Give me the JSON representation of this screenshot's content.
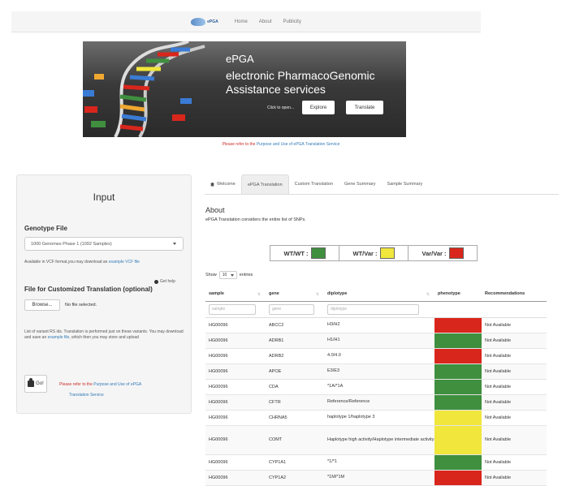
{
  "navbar": {
    "logo_text": "ePGA",
    "links": [
      "Home",
      "About",
      "Publicity"
    ]
  },
  "banner": {
    "title": "ePGA",
    "line1": "electronic PharmacoGenomic",
    "line2": "Assistance services",
    "click_text": "Click to open...",
    "explore_label": "Explore",
    "translate_label": "Translate",
    "note_prefix": "Please refer to the ",
    "note_link": "Purpose and Use of ePGA Translation Service"
  },
  "input_panel": {
    "title": "Input",
    "genotype_label": "Genotype File",
    "genotype_selected": "1000 Genomes Phase 1 (1092 Samples)",
    "help_text": "Available in VCF format,you may download an ",
    "help_link": "example VCF file",
    "get_help": "Get help",
    "custom_label": "File for Customized Translation (optional)",
    "browse_label": "Browse...",
    "no_file": "No file selected.",
    "variant_text": "List of variant RS ids. Translation is performed just on these variants. You may download and save an ",
    "variant_link": "example file",
    "variant_text_end": ", which then you may store and upload",
    "go_label": "Go!",
    "purpose_prefix": "Please refer to the ",
    "purpose_link1": "Purpose and Use of ePGA",
    "purpose_link2": "Translation Service"
  },
  "tabs": [
    {
      "label": "Welcome",
      "active": false
    },
    {
      "label": "ePGA Translation",
      "active": true
    },
    {
      "label": "Custom Translation",
      "active": false
    },
    {
      "label": "Gene Summary",
      "active": false
    },
    {
      "label": "Sample Summary",
      "active": false
    }
  ],
  "about": {
    "heading": "About",
    "text": "ePGA Translation considers the entire list of SNPs."
  },
  "legend": [
    {
      "label": "WT/WT :",
      "color": "#3f8f3f"
    },
    {
      "label": "WT/Var :",
      "color": "#f0e63c"
    },
    {
      "label": "Var/Var :",
      "color": "#d9261c"
    }
  ],
  "table": {
    "show_label": "Show",
    "length_value": "10",
    "entries_label": "entries",
    "columns": [
      "sample",
      "gene",
      "diplotype",
      "phenotype",
      "Recommendations"
    ],
    "filter_placeholders": [
      "sample",
      "gene",
      "diplotype"
    ],
    "rows": [
      {
        "sample": "HG00096",
        "gene": "ABCC2",
        "diplotype": "H3/H2",
        "phenotype_color": "#d9261c",
        "recommendation": "Not Available"
      },
      {
        "sample": "HG00096",
        "gene": "ADRB1",
        "diplotype": "H1/H1",
        "phenotype_color": "#3f8f3f",
        "recommendation": "Not Available"
      },
      {
        "sample": "HG00096",
        "gene": "ADRB2",
        "diplotype": "4.0/4.0",
        "phenotype_color": "#d9261c",
        "recommendation": "Not Available"
      },
      {
        "sample": "HG00096",
        "gene": "APOE",
        "diplotype": "E3/E3",
        "phenotype_color": "#3f8f3f",
        "recommendation": "Not Available"
      },
      {
        "sample": "HG00096",
        "gene": "CDA",
        "diplotype": "*1A/*1A",
        "phenotype_color": "#3f8f3f",
        "recommendation": "Not Available"
      },
      {
        "sample": "HG00096",
        "gene": "CFTR",
        "diplotype": "Reference/Reference",
        "phenotype_color": "#3f8f3f",
        "recommendation": "Not Available"
      },
      {
        "sample": "HG00096",
        "gene": "CHRNA5",
        "diplotype": "haplotype 1/haplotype 3",
        "phenotype_color": "#f0e63c",
        "recommendation": "Not Available"
      },
      {
        "sample": "HG00096",
        "gene": "COMT",
        "diplotype": "Haplotype high activity/Haplotype intermediate activity",
        "phenotype_color": "#f0e63c",
        "recommendation": "Not Available"
      },
      {
        "sample": "HG00096",
        "gene": "CYP1A1",
        "diplotype": "*1/*1",
        "phenotype_color": "#3f8f3f",
        "recommendation": "Not Available"
      },
      {
        "sample": "HG00096",
        "gene": "CYP1A2",
        "diplotype": "*1M/*1M",
        "phenotype_color": "#d9261c",
        "recommendation": "Not Available"
      }
    ]
  }
}
